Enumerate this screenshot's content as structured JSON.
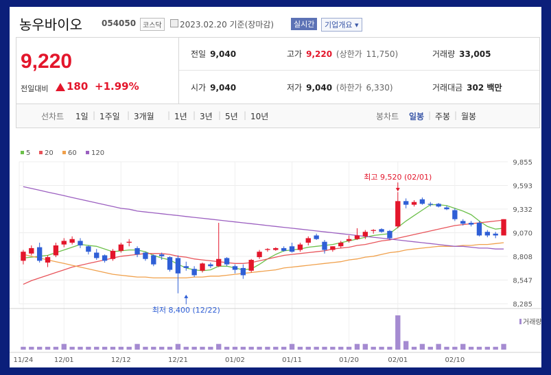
{
  "header": {
    "name": "농우바이오",
    "code": "054050",
    "market": "코스닥",
    "date_text": "2023.02.20 기준(장마감)",
    "realtime": "실시간",
    "overview": "기업개요 ▾"
  },
  "quote": {
    "price": "9,220",
    "change_label": "전일대비",
    "change": "180",
    "change_pct": "+1.99%",
    "prev_label": "전일",
    "prev": "9,040",
    "high_label": "고가",
    "high": "9,220",
    "upper_label": "(상한가",
    "upper": "11,750)",
    "volume_label": "거래량",
    "volume": "33,005",
    "open_label": "시가",
    "open": "9,040",
    "low_label": "저가",
    "low": "9,040",
    "lower_label": "(하한가",
    "lower": "6,330)",
    "amount_label": "거래대금",
    "amount": "302 백만"
  },
  "periods": {
    "line_label": "선차트",
    "line": [
      "1일",
      "1주일",
      "3개월",
      "1년",
      "3년",
      "5년",
      "10년"
    ],
    "candle_label": "봉차트",
    "candle": [
      "일봉",
      "주봉",
      "월봉"
    ],
    "candle_selected": "일봉"
  },
  "colors": {
    "up": "#e3162b",
    "down": "#2f5fd6",
    "ma5": "#6cc04a",
    "ma20": "#e8545a",
    "ma60": "#f0a04b",
    "ma120": "#9b5fc0",
    "volume": "#a58bd1"
  },
  "chart_data": {
    "type": "candlestick",
    "legend": [
      "5",
      "20",
      "60",
      "120"
    ],
    "y_ticks": [
      "9,855",
      "9,593",
      "9,332",
      "9,070",
      "8,808",
      "8,547",
      "8,285"
    ],
    "ylim": [
      8285,
      9855
    ],
    "x_labels": [
      {
        "i": 0,
        "label": "11/24"
      },
      {
        "i": 5,
        "label": "12/01"
      },
      {
        "i": 12,
        "label": "12/12"
      },
      {
        "i": 19,
        "label": "12/21"
      },
      {
        "i": 26,
        "label": "01/02"
      },
      {
        "i": 33,
        "label": "01/11"
      },
      {
        "i": 40,
        "label": "01/20"
      },
      {
        "i": 46,
        "label": "02/01"
      },
      {
        "i": 53,
        "label": "02/10"
      }
    ],
    "high_note": "최고 9,520 (02/01)",
    "low_note": "최저 8,400 (12/22)",
    "high_index": 46,
    "high_value": 9520,
    "low_index": 20,
    "low_value": 8400,
    "volume_label": "거래량",
    "candles": [
      {
        "o": 8760,
        "h": 8880,
        "l": 8720,
        "c": 8860
      },
      {
        "o": 8840,
        "h": 8930,
        "l": 8820,
        "c": 8900
      },
      {
        "o": 8910,
        "h": 8960,
        "l": 8740,
        "c": 8760
      },
      {
        "o": 8740,
        "h": 8820,
        "l": 8690,
        "c": 8800
      },
      {
        "o": 8820,
        "h": 8960,
        "l": 8800,
        "c": 8930
      },
      {
        "o": 8940,
        "h": 9010,
        "l": 8910,
        "c": 8980
      },
      {
        "o": 8960,
        "h": 9030,
        "l": 8940,
        "c": 9000
      },
      {
        "o": 8980,
        "h": 9010,
        "l": 8900,
        "c": 8930
      },
      {
        "o": 8920,
        "h": 8930,
        "l": 8830,
        "c": 8860
      },
      {
        "o": 8850,
        "h": 8890,
        "l": 8770,
        "c": 8790
      },
      {
        "o": 8820,
        "h": 8830,
        "l": 8740,
        "c": 8760
      },
      {
        "o": 8780,
        "h": 8890,
        "l": 8760,
        "c": 8870
      },
      {
        "o": 8870,
        "h": 8960,
        "l": 8850,
        "c": 8940
      },
      {
        "o": 8960,
        "h": 9000,
        "l": 8920,
        "c": 8970
      },
      {
        "o": 8900,
        "h": 8920,
        "l": 8800,
        "c": 8830
      },
      {
        "o": 8850,
        "h": 8860,
        "l": 8760,
        "c": 8780
      },
      {
        "o": 8820,
        "h": 8830,
        "l": 8700,
        "c": 8720
      },
      {
        "o": 8830,
        "h": 8850,
        "l": 8770,
        "c": 8810
      },
      {
        "o": 8800,
        "h": 8810,
        "l": 8640,
        "c": 8660
      },
      {
        "o": 8790,
        "h": 8820,
        "l": 8400,
        "c": 8620
      },
      {
        "o": 8700,
        "h": 8750,
        "l": 8650,
        "c": 8680
      },
      {
        "o": 8670,
        "h": 8700,
        "l": 8580,
        "c": 8600
      },
      {
        "o": 8650,
        "h": 8740,
        "l": 8630,
        "c": 8730
      },
      {
        "o": 8720,
        "h": 8740,
        "l": 8680,
        "c": 8700
      },
      {
        "o": 8700,
        "h": 9180,
        "l": 8690,
        "c": 8780
      },
      {
        "o": 8790,
        "h": 8800,
        "l": 8700,
        "c": 8720
      },
      {
        "o": 8700,
        "h": 8720,
        "l": 8620,
        "c": 8660
      },
      {
        "o": 8680,
        "h": 8720,
        "l": 8560,
        "c": 8600
      },
      {
        "o": 8650,
        "h": 8780,
        "l": 8630,
        "c": 8770
      },
      {
        "o": 8800,
        "h": 8880,
        "l": 8780,
        "c": 8860
      },
      {
        "o": 8880,
        "h": 8900,
        "l": 8860,
        "c": 8890
      },
      {
        "o": 8880,
        "h": 8910,
        "l": 8870,
        "c": 8900
      },
      {
        "o": 8900,
        "h": 8920,
        "l": 8860,
        "c": 8870
      },
      {
        "o": 8920,
        "h": 8960,
        "l": 8850,
        "c": 8860
      },
      {
        "o": 8880,
        "h": 8960,
        "l": 8860,
        "c": 8940
      },
      {
        "o": 8960,
        "h": 9030,
        "l": 8930,
        "c": 9010
      },
      {
        "o": 9040,
        "h": 9060,
        "l": 8990,
        "c": 9000
      },
      {
        "o": 8970,
        "h": 8990,
        "l": 8840,
        "c": 8880
      },
      {
        "o": 8880,
        "h": 8920,
        "l": 8860,
        "c": 8920
      },
      {
        "o": 8920,
        "h": 8980,
        "l": 8900,
        "c": 8960
      },
      {
        "o": 8980,
        "h": 9040,
        "l": 8960,
        "c": 9000
      },
      {
        "o": 9000,
        "h": 9120,
        "l": 8990,
        "c": 9040
      },
      {
        "o": 9030,
        "h": 9100,
        "l": 9000,
        "c": 9080
      },
      {
        "o": 9090,
        "h": 9110,
        "l": 9060,
        "c": 9100
      },
      {
        "o": 9110,
        "h": 9120,
        "l": 9070,
        "c": 9080
      },
      {
        "o": 9090,
        "h": 9100,
        "l": 8990,
        "c": 9010
      },
      {
        "o": 9140,
        "h": 9520,
        "l": 9120,
        "c": 9420
      },
      {
        "o": 9420,
        "h": 9450,
        "l": 9340,
        "c": 9380
      },
      {
        "o": 9380,
        "h": 9430,
        "l": 9360,
        "c": 9410
      },
      {
        "o": 9440,
        "h": 9460,
        "l": 9380,
        "c": 9390
      },
      {
        "o": 9390,
        "h": 9410,
        "l": 9360,
        "c": 9380
      },
      {
        "o": 9390,
        "h": 9400,
        "l": 9350,
        "c": 9360
      },
      {
        "o": 9350,
        "h": 9370,
        "l": 9320,
        "c": 9330
      },
      {
        "o": 9320,
        "h": 9340,
        "l": 9200,
        "c": 9220
      },
      {
        "o": 9200,
        "h": 9220,
        "l": 9150,
        "c": 9170
      },
      {
        "o": 9180,
        "h": 9200,
        "l": 9140,
        "c": 9160
      },
      {
        "o": 9180,
        "h": 9200,
        "l": 9030,
        "c": 9040
      },
      {
        "o": 9080,
        "h": 9100,
        "l": 9020,
        "c": 9040
      },
      {
        "o": 9060,
        "h": 9080,
        "l": 9010,
        "c": 9040
      },
      {
        "o": 9040,
        "h": 9220,
        "l": 9040,
        "c": 9220
      }
    ],
    "volume": [
      1,
      1,
      1,
      1,
      1,
      2,
      1,
      1,
      1,
      1,
      1,
      1,
      1,
      1,
      2,
      1,
      1,
      1,
      1,
      2,
      1,
      1,
      1,
      1,
      2,
      1,
      1,
      1,
      1,
      1,
      1,
      1,
      1,
      2,
      1,
      1,
      1,
      1,
      1,
      1,
      1,
      2,
      2,
      1,
      1,
      1,
      12,
      3,
      1,
      2,
      1,
      2,
      1,
      1,
      2,
      1,
      1,
      1,
      1,
      2
    ],
    "series": [
      {
        "name": "5",
        "values": [
          8790,
          8800,
          8810,
          8820,
          8850,
          8880,
          8910,
          8940,
          8930,
          8920,
          8890,
          8860,
          8870,
          8880,
          8880,
          8860,
          8820,
          8790,
          8770,
          8720,
          8680,
          8660,
          8650,
          8660,
          8700,
          8700,
          8680,
          8660,
          8670,
          8720,
          8780,
          8830,
          8870,
          8880,
          8890,
          8910,
          8920,
          8930,
          8940,
          8960,
          8980,
          9000,
          9020,
          9040,
          9050,
          9060,
          9130,
          9200,
          9260,
          9320,
          9380,
          9380,
          9370,
          9340,
          9310,
          9270,
          9200,
          9140,
          9110,
          9120
        ]
      },
      {
        "name": "20",
        "values": [
          8500,
          8540,
          8570,
          8600,
          8630,
          8660,
          8690,
          8710,
          8730,
          8750,
          8770,
          8790,
          8810,
          8820,
          8830,
          8840,
          8840,
          8840,
          8830,
          8810,
          8800,
          8780,
          8770,
          8760,
          8750,
          8740,
          8730,
          8730,
          8740,
          8760,
          8780,
          8800,
          8820,
          8830,
          8840,
          8850,
          8860,
          8870,
          8890,
          8900,
          8910,
          8930,
          8940,
          8960,
          8980,
          8990,
          9010,
          9030,
          9050,
          9070,
          9090,
          9110,
          9130,
          9150,
          9160,
          9170,
          9180,
          9190,
          9200,
          9210
        ]
      },
      {
        "name": "60",
        "values": [
          8830,
          8810,
          8790,
          8770,
          8750,
          8730,
          8710,
          8690,
          8670,
          8650,
          8630,
          8610,
          8600,
          8590,
          8580,
          8580,
          8570,
          8570,
          8570,
          8570,
          8570,
          8580,
          8580,
          8590,
          8590,
          8600,
          8610,
          8620,
          8630,
          8640,
          8650,
          8660,
          8680,
          8690,
          8700,
          8710,
          8720,
          8730,
          8740,
          8750,
          8770,
          8780,
          8800,
          8810,
          8830,
          8850,
          8860,
          8880,
          8890,
          8900,
          8910,
          8920,
          8920,
          8920,
          8930,
          8930,
          8940,
          8940,
          8950,
          8960
        ]
      },
      {
        "name": "120",
        "values": [
          9580,
          9560,
          9540,
          9520,
          9500,
          9480,
          9460,
          9440,
          9420,
          9400,
          9380,
          9360,
          9340,
          9330,
          9310,
          9300,
          9290,
          9280,
          9270,
          9260,
          9250,
          9240,
          9230,
          9220,
          9210,
          9200,
          9190,
          9180,
          9170,
          9160,
          9150,
          9140,
          9130,
          9120,
          9110,
          9100,
          9090,
          9080,
          9070,
          9060,
          9050,
          9040,
          9030,
          9020,
          9010,
          9000,
          8990,
          8980,
          8970,
          8960,
          8950,
          8940,
          8930,
          8920,
          8920,
          8910,
          8900,
          8900,
          8890,
          8890
        ]
      }
    ]
  }
}
